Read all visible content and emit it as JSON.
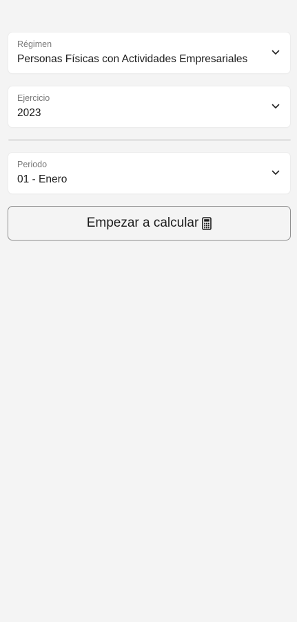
{
  "regimen": {
    "label": "Régimen",
    "value": "Personas Físicas con Actividades Empresariales",
    "icon": "chevron-down-icon"
  },
  "ejercicio": {
    "label": "Ejercicio",
    "value": "2023",
    "icon": "chevron-down-icon"
  },
  "periodo": {
    "label": "Periodo",
    "value": "01 - Enero",
    "icon": "chevron-down-icon"
  },
  "start_button": {
    "label": "Empezar a calcular",
    "icon": "calculator-icon"
  },
  "colors": {
    "background": "#f4f4f4",
    "card": "#ffffff",
    "label": "#777777",
    "text": "#1c1c1c",
    "button_border": "#8f8f8f"
  }
}
